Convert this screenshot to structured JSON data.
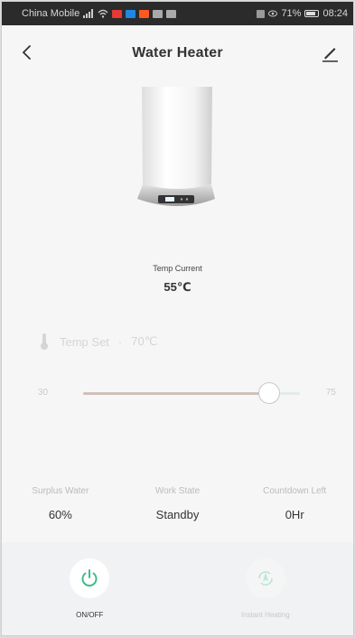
{
  "status_bar": {
    "carrier": "China Mobile",
    "battery": "71%",
    "time": "08:24",
    "colors": {
      "red": "#e53935",
      "blue": "#1e88e5",
      "orange": "#ff5722"
    }
  },
  "nav": {
    "title": "Water Heater",
    "back_icon": "chevron-left-icon",
    "edit_icon": "pencil-icon"
  },
  "temp_current": {
    "label": "Temp Current",
    "value": "55℃"
  },
  "temp_set": {
    "label": "Temp Set",
    "value": "70℃",
    "icon": "thermometer-icon"
  },
  "slider": {
    "min": "30",
    "max": "75",
    "value_fraction": 0.86
  },
  "stats": [
    {
      "label": "Surplus Water",
      "value": "60%"
    },
    {
      "label": "Work State",
      "value": "Standby"
    },
    {
      "label": "Countdown Left",
      "value": "0Hr"
    }
  ],
  "actions": [
    {
      "label": "ON/OFF",
      "icon": "power-icon",
      "color": "#3dbb8a"
    },
    {
      "label": "Instant Heating",
      "icon": "instant-heating-icon",
      "color": "#9fe0c6"
    }
  ]
}
